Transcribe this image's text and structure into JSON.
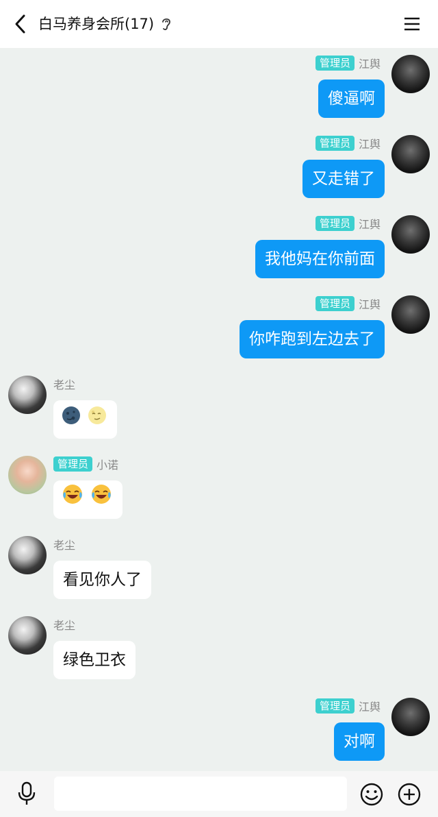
{
  "header": {
    "title": "白马养身会所(17)",
    "icons": {
      "back": "chevron-left-icon",
      "ear": "ear-icon",
      "menu": "hamburger-menu-icon"
    }
  },
  "messages": [
    {
      "side": "right",
      "badge": "管理员",
      "name": "江舆",
      "text": "傻逼啊"
    },
    {
      "side": "right",
      "badge": "管理员",
      "name": "江舆",
      "text": "又走错了"
    },
    {
      "side": "right",
      "badge": "管理员",
      "name": "江舆",
      "text": "我他妈在你前面"
    },
    {
      "side": "right",
      "badge": "管理员",
      "name": "江舆",
      "text": "你咋跑到左边去了"
    },
    {
      "side": "left",
      "badge": "",
      "name": "老尘",
      "emojis": [
        "new-moon-face-emoji",
        "full-moon-face-emoji"
      ]
    },
    {
      "side": "left",
      "badge": "管理员",
      "name": "小诺",
      "emojis": [
        "laughing-crying-emoji",
        "laughing-crying-emoji"
      ]
    },
    {
      "side": "left",
      "badge": "",
      "name": "老尘",
      "text": "看见你人了"
    },
    {
      "side": "left",
      "badge": "",
      "name": "老尘",
      "text": "绿色卫衣"
    },
    {
      "side": "right",
      "badge": "管理员",
      "name": "江舆",
      "text": "对啊"
    }
  ],
  "colors": {
    "background": "#edf1ef",
    "my_bubble": "#0e99f6",
    "admin_badge": "#3dd0cf"
  },
  "input": {
    "placeholder": "",
    "value": ""
  }
}
